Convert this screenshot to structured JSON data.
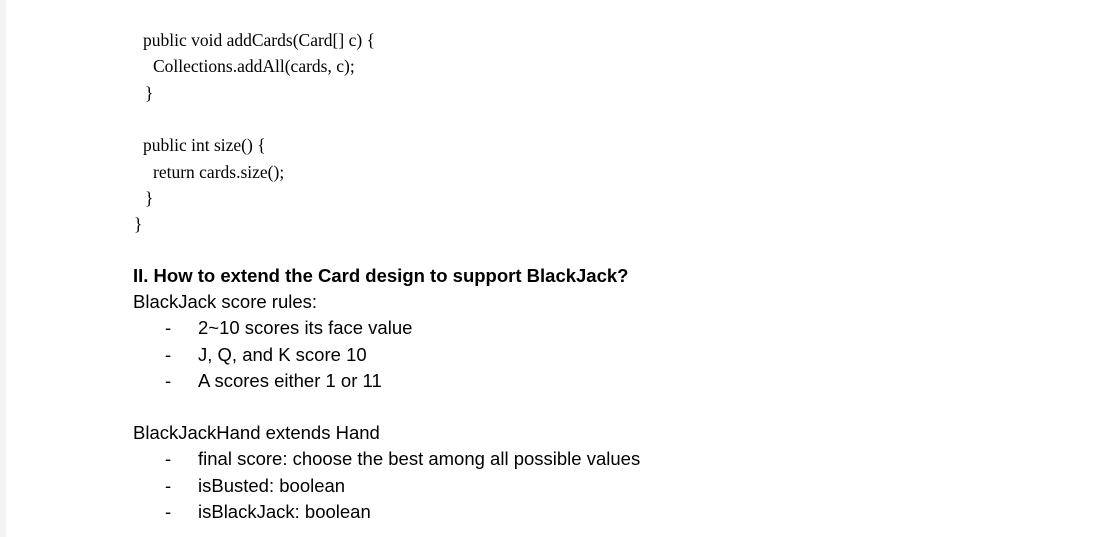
{
  "code": {
    "lines": [
      "public void addCards(Card[] c) {",
      "Collections.addAll(cards, c);",
      "}",
      "public int size() {",
      "return cards.size();",
      "}",
      "}"
    ]
  },
  "section": {
    "heading": "II. How to extend the Card design to support BlackJack?",
    "rules_intro": "BlackJack score rules:",
    "rules": [
      "2~10 scores its face value",
      "J, Q, and K score 10",
      "A scores either 1 or 11"
    ],
    "hand_intro": "BlackJackHand extends Hand",
    "hand_items": [
      "final score: choose the best among all possible values",
      "isBusted: boolean",
      "isBlackJack: boolean"
    ],
    "bullet_marker": "-"
  }
}
